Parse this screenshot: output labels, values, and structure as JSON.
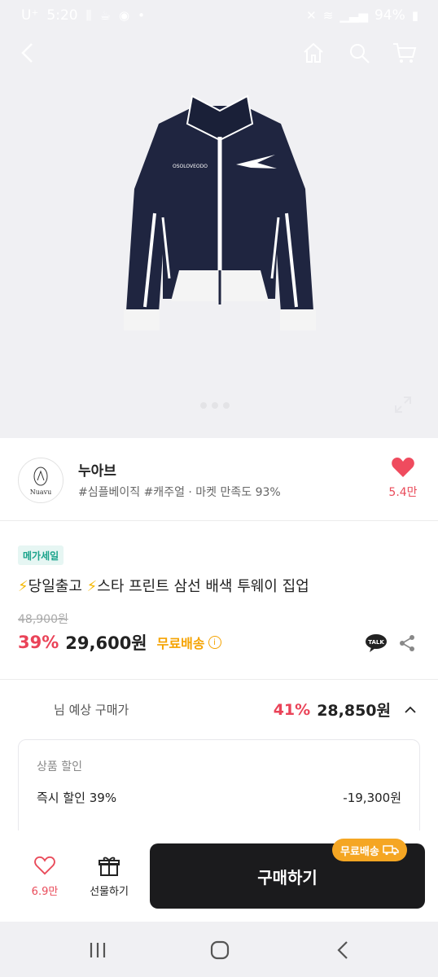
{
  "status": {
    "carrier": "U⁺",
    "time": "5:20",
    "battery": "94%"
  },
  "nav": {
    "icons": [
      "back-icon",
      "home-icon",
      "search-icon",
      "cart-icon"
    ]
  },
  "jacket_print": "OSOLOVEODO",
  "seller": {
    "logo_text": "Nuavu",
    "name": "누아브",
    "tags": "#심플베이직 #캐주얼 · 마켓 만족도 93%",
    "likes": "5.4만"
  },
  "product": {
    "badge": "메가세일",
    "title": "당일출고",
    "title_rest": "스타 프린트 삼선 배색 투웨이 집업",
    "original_price": "48,900원",
    "discount": "39%",
    "price": "29,600원",
    "shipping": "무료배송",
    "talk_label": "TALK"
  },
  "expected": {
    "label": "님 예상 구매가",
    "discount": "41%",
    "price": "28,850원"
  },
  "discount_box": {
    "title": "상품 할인",
    "row_label": "즉시 할인 39%",
    "row_value": "-19,300원"
  },
  "purchase": {
    "likes": "6.9만",
    "gift_label": "선물하기",
    "buy_label": "구매하기",
    "ship_pill": "무료배송"
  },
  "colors": {
    "accent_red": "#ea4358",
    "ship_orange": "#f5a623",
    "badge_green": "#1aa38b",
    "buy_dark": "#1b1b1d"
  }
}
